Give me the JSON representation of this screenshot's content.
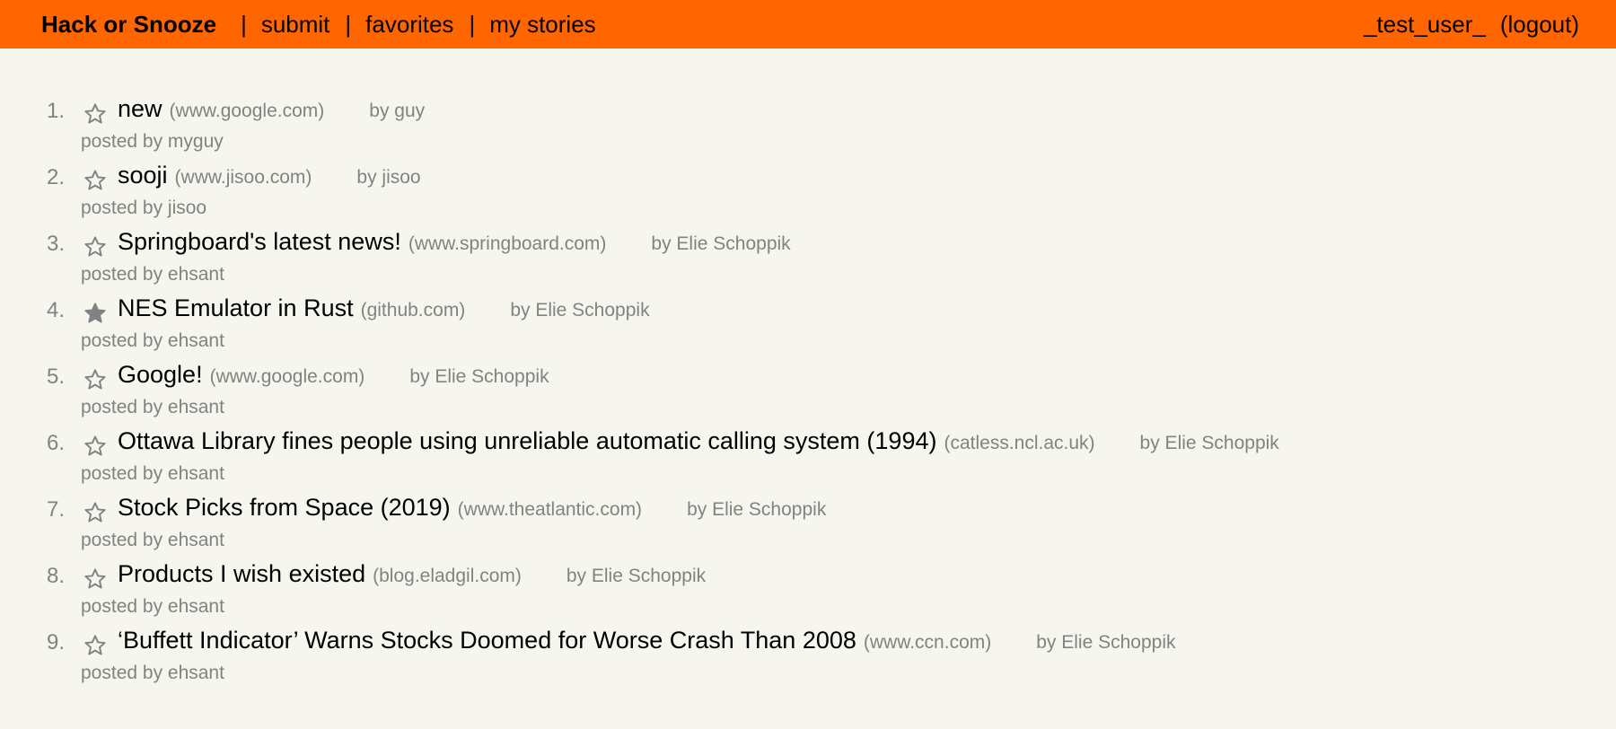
{
  "nav": {
    "brand": "Hack or Snooze",
    "sep": "|",
    "submit": "submit",
    "favorites": "favorites",
    "my_stories": "my stories",
    "user": "_test_user_",
    "logout": "(logout)"
  },
  "stories": [
    {
      "num": "1.",
      "title": "new",
      "host": "(www.google.com)",
      "author": "by guy",
      "user": "posted by myguy",
      "favorite": false
    },
    {
      "num": "2.",
      "title": "sooji",
      "host": "(www.jisoo.com)",
      "author": "by jisoo",
      "user": "posted by jisoo",
      "favorite": false
    },
    {
      "num": "3.",
      "title": "Springboard's latest news!",
      "host": "(www.springboard.com)",
      "author": "by Elie Schoppik",
      "user": "posted by ehsant",
      "favorite": false
    },
    {
      "num": "4.",
      "title": "NES Emulator in Rust",
      "host": "(github.com)",
      "author": "by Elie Schoppik",
      "user": "posted by ehsant",
      "favorite": true
    },
    {
      "num": "5.",
      "title": "Google!",
      "host": "(www.google.com)",
      "author": "by Elie Schoppik",
      "user": "posted by ehsant",
      "favorite": false
    },
    {
      "num": "6.",
      "title": "Ottawa Library fines people using unreliable automatic calling system (1994)",
      "host": "(catless.ncl.ac.uk)",
      "author": "by Elie Schoppik",
      "user": "posted by ehsant",
      "favorite": false
    },
    {
      "num": "7.",
      "title": "Stock Picks from Space (2019)",
      "host": "(www.theatlantic.com)",
      "author": "by Elie Schoppik",
      "user": "posted by ehsant",
      "favorite": false
    },
    {
      "num": "8.",
      "title": "Products I wish existed",
      "host": "(blog.eladgil.com)",
      "author": "by Elie Schoppik",
      "user": "posted by ehsant",
      "favorite": false
    },
    {
      "num": "9.",
      "title": "‘Buffett Indicator’ Warns Stocks Doomed for Worse Crash Than 2008",
      "host": "(www.ccn.com)",
      "author": "by Elie Schoppik",
      "user": "posted by ehsant",
      "favorite": false
    }
  ],
  "icons": {
    "favorite": "star-icon",
    "star_outline_color": "#828282",
    "star_fill_color": "#828282"
  },
  "colors": {
    "navbar": "#ff6600",
    "background": "#f6f6ef",
    "muted": "#828282"
  }
}
